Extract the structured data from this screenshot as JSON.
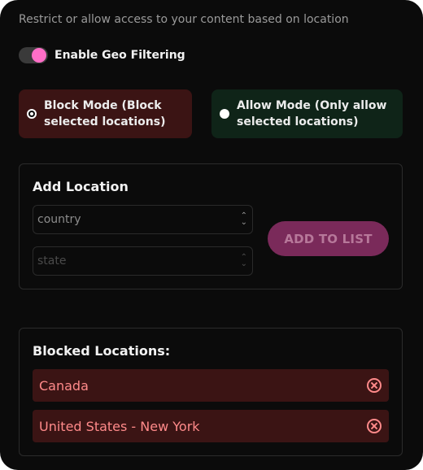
{
  "description": "Restrict or allow access to your content based on location",
  "geo_filter": {
    "label": "Enable Geo Filtering",
    "enabled": true
  },
  "modes": {
    "block": {
      "label": "Block Mode (Block selected locations)",
      "selected": true
    },
    "allow": {
      "label": "Allow Mode (Only allow selected locations)",
      "selected": false
    }
  },
  "add_location": {
    "title": "Add Location",
    "country_placeholder": "country",
    "state_placeholder": "state",
    "add_button": "ADD TO LIST"
  },
  "blocked": {
    "title": "Blocked Locations:",
    "items": [
      "Canada",
      "United States - New York"
    ]
  },
  "colors": {
    "accent_pink": "#ff6ec7",
    "block_bg": "#3b1414",
    "allow_bg": "#0f2418",
    "blocked_text": "#ff8a8a"
  }
}
